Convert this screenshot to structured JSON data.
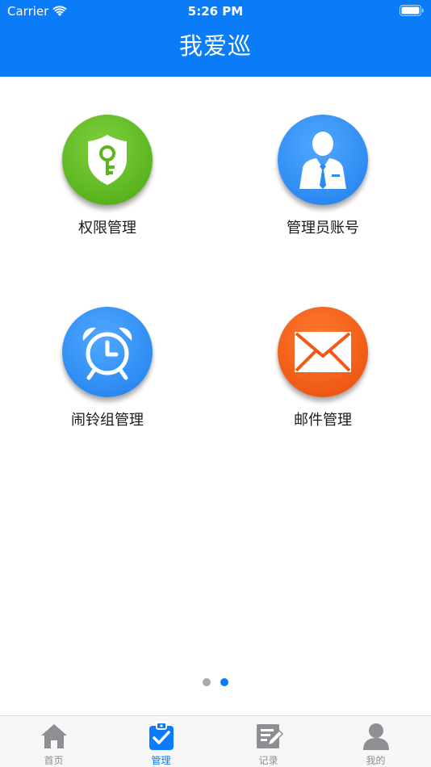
{
  "status_bar": {
    "carrier": "Carrier",
    "time": "5:26 PM"
  },
  "header": {
    "title": "我爱巡"
  },
  "grid": [
    {
      "label": "权限管理",
      "icon": "shield-key-icon",
      "color": "#5BB51F"
    },
    {
      "label": "管理员账号",
      "icon": "admin-user-icon",
      "color": "#2E8BF2"
    },
    {
      "label": "闹铃组管理",
      "icon": "alarm-clock-icon",
      "color": "#2E8BF2"
    },
    {
      "label": "邮件管理",
      "icon": "envelope-icon",
      "color": "#F05A16"
    }
  ],
  "pager": {
    "count": 2,
    "active_index": 1
  },
  "tabbar": {
    "tabs": [
      {
        "label": "首页",
        "icon": "home-icon",
        "active": false
      },
      {
        "label": "管理",
        "icon": "clipboard-check-icon",
        "active": true
      },
      {
        "label": "记录",
        "icon": "edit-record-icon",
        "active": false
      },
      {
        "label": "我的",
        "icon": "person-icon",
        "active": false
      }
    ]
  },
  "colors": {
    "brand": "#0A7CF8",
    "inactive": "#8e8e93"
  }
}
